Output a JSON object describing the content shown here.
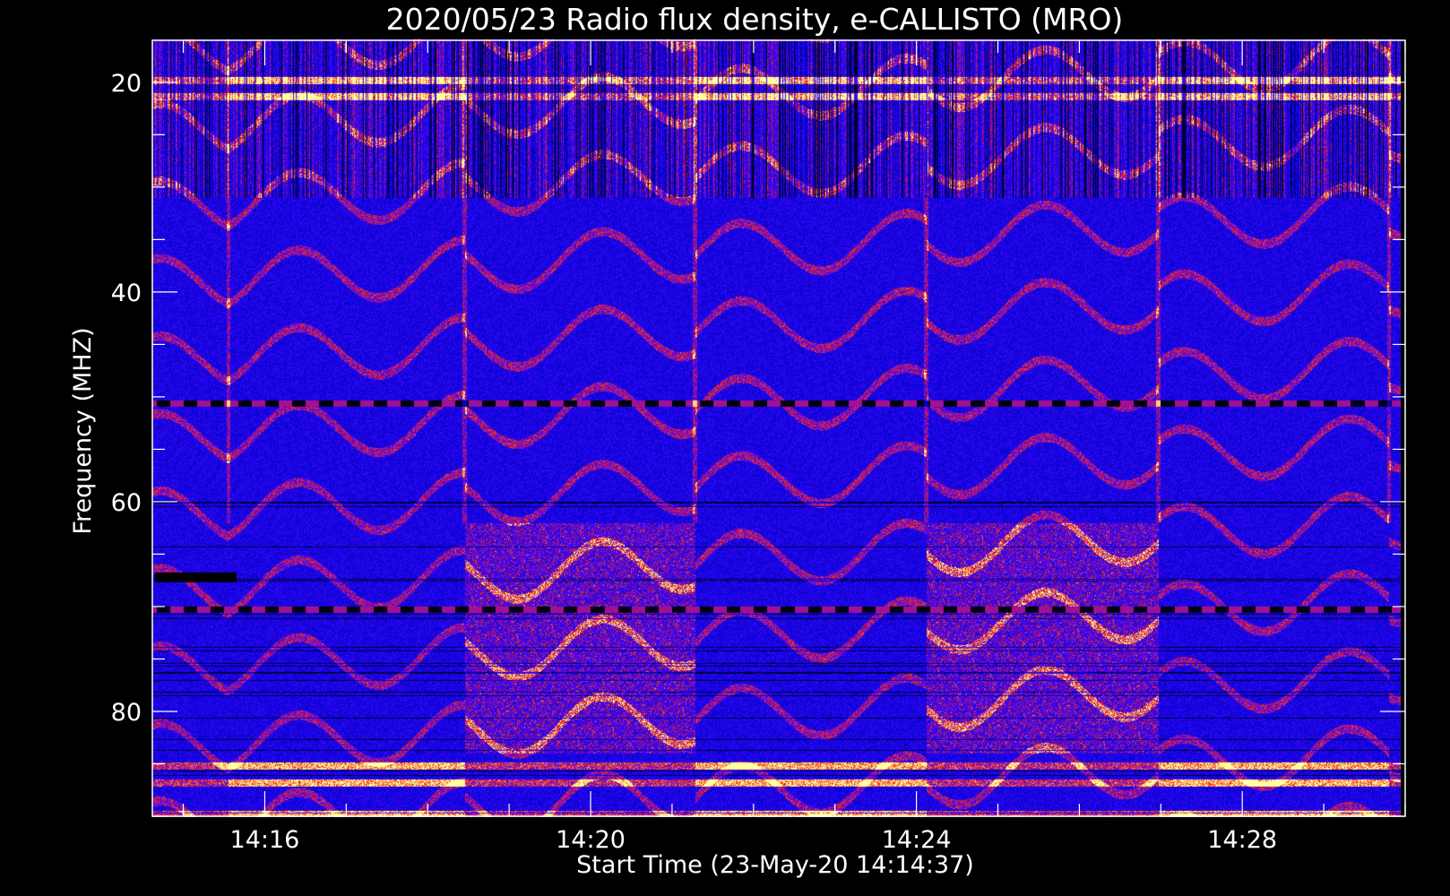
{
  "chart_data": {
    "type": "heatmap",
    "title": "2020/05/23  Radio flux density, e-CALLISTO (MRO)",
    "xlabel": "Start Time (23-May-20 14:14:37)",
    "ylabel": "Frequency (MHZ)",
    "x_axis": {
      "start": "14:14:37",
      "end": "14:30:00",
      "range_minutes": [
        14.62,
        30.0
      ],
      "major_ticks": [
        {
          "value": 16,
          "label": "14:16"
        },
        {
          "value": 20,
          "label": "14:20"
        },
        {
          "value": 24,
          "label": "14:24"
        },
        {
          "value": 28,
          "label": "14:28"
        }
      ],
      "minor_tick_step": 1
    },
    "y_axis": {
      "range": [
        90,
        16
      ],
      "inverted": true,
      "major_ticks": [
        {
          "value": 20,
          "label": "20"
        },
        {
          "value": 40,
          "label": "40"
        },
        {
          "value": 60,
          "label": "60"
        },
        {
          "value": 80,
          "label": "80"
        }
      ],
      "minor_tick_step": 5
    },
    "colormap": [
      "#000000",
      "#0000ff",
      "#ff2000",
      "#ffff80"
    ],
    "background_color": "#0a0ae8",
    "data_extent": {
      "t_start": 14.62,
      "t_end": 29.95,
      "f_top": 15.9,
      "f_bottom": 90.1
    },
    "segment_boundaries_minutes": [
      15.55,
      18.45,
      21.28,
      24.12,
      26.97,
      29.8
    ],
    "bright_bands_mhz": [
      19.8,
      21.3,
      85.2,
      86.8,
      89.8
    ],
    "notable_features": [
      {
        "type": "interference_line",
        "frequency_mhz": 50.6
      },
      {
        "type": "interference_line",
        "frequency_mhz": 70.3
      },
      {
        "type": "dark_bar",
        "frequency_mhz": 67.2,
        "t_start": 14.65,
        "t_end": 15.65
      }
    ]
  }
}
